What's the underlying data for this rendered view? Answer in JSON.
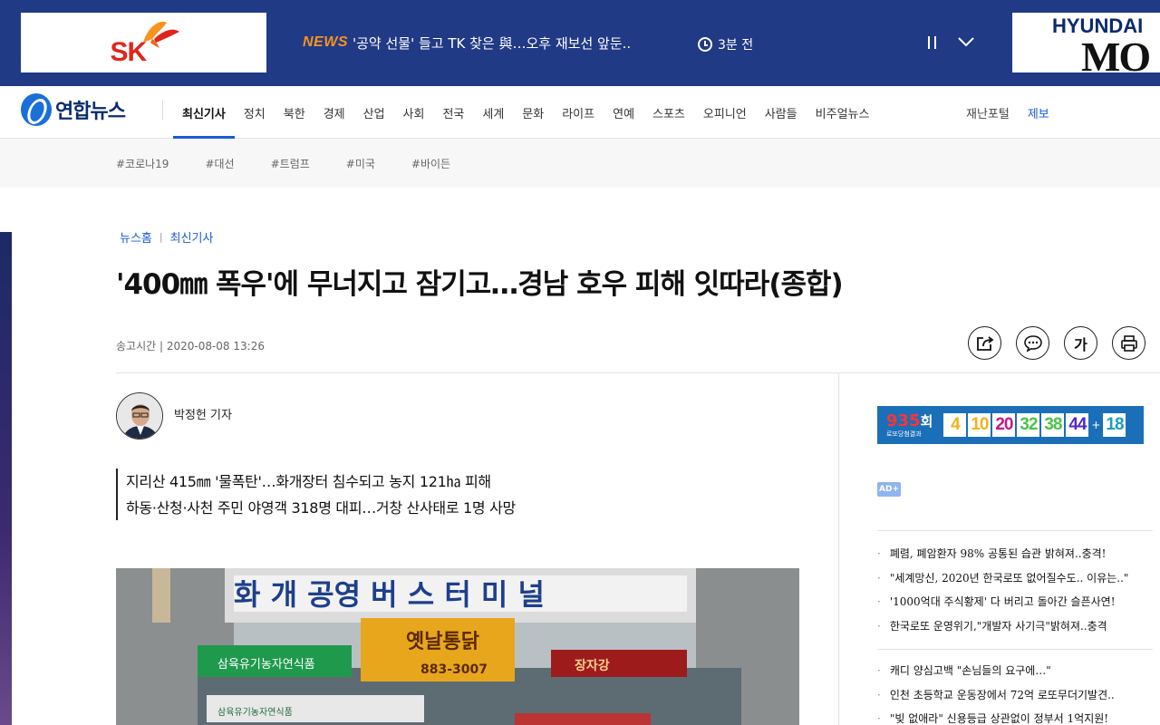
{
  "top_ad": {
    "left_brand": "SK",
    "news_tag": "NEWS",
    "news_headline": "'공약 선물' 들고 TK 찾은 與…오후 재보선 앞둔..",
    "news_time": "3분 전",
    "right_brand_top": "HYUNDAI",
    "right_brand_bottom": "MO"
  },
  "nav": {
    "logo_text": "연합뉴스",
    "menu": [
      "최신기사",
      "정치",
      "북한",
      "경제",
      "산업",
      "사회",
      "전국",
      "세계",
      "문화",
      "라이프",
      "연예",
      "스포츠",
      "오피니언",
      "사람들",
      "비주얼뉴스"
    ],
    "disaster_portal": "재난포털",
    "report": "제보"
  },
  "hashtags": [
    "#코로나19",
    "#대선",
    "#트럼프",
    "#미국",
    "#바이든"
  ],
  "article": {
    "breadcrumb_home": "뉴스홈",
    "breadcrumb_section": "최신기사",
    "headline": "'400㎜ 폭우'에 무너지고 잠기고…경남 호우 피해 잇따라(종합)",
    "sent_time": "송고시간 | 2020-08-08 13:26",
    "font_tool_label": "가",
    "reporter": "박정헌 기자",
    "summary": [
      "지리산 415㎜ '물폭탄'…화개장터 침수되고 농지 121㏊ 피해",
      "하동·산청·사천 주민 야영객 318명 대피…거창 산사태로 1명 사망"
    ],
    "photo": {
      "sign_main": "화 개 공영 버 스 터 미 널",
      "shop1": "삼육유기농자연식품",
      "shop2": "옛날통닭",
      "shop2_phone": "883-3007",
      "shop3": "장자강",
      "shop1_lower": "삼육유기농자연식품"
    }
  },
  "sidebar": {
    "lotto": {
      "round": "935",
      "round_suffix": "회",
      "round_sub": "로또당첨결과",
      "numbers": [
        {
          "n": "4",
          "color": "#f2b21b"
        },
        {
          "n": "10",
          "color": "#f2b21b"
        },
        {
          "n": "20",
          "color": "#c2188a"
        },
        {
          "n": "32",
          "color": "#4cc24a"
        },
        {
          "n": "38",
          "color": "#4cc24a"
        },
        {
          "n": "44",
          "color": "#5526c8"
        }
      ],
      "plus": "+",
      "bonus": {
        "n": "18",
        "color": "#1aa0b8"
      }
    },
    "ad_badge": "AD",
    "list_a": [
      "폐렴, 폐암환자 98% 공통된 습관 밝혀져..충격!",
      "\"세계망신, 2020년 한국로또 없어질수도.. 이유는..\"",
      "'1000억대 주식황제' 다 버리고 돌아간 슬픈사연!",
      "한국로또 운영위기,\"개발자 사기극\"밝혀져..충격"
    ],
    "list_b": [
      "캐디 양심고백 \"손님들의 요구에…\"",
      "인천 초등학교 운동장에서 72억 로또무더기발견..",
      "\"빚 없애라\" 신용등급 상관없이 정부서 1억지원!"
    ]
  }
}
